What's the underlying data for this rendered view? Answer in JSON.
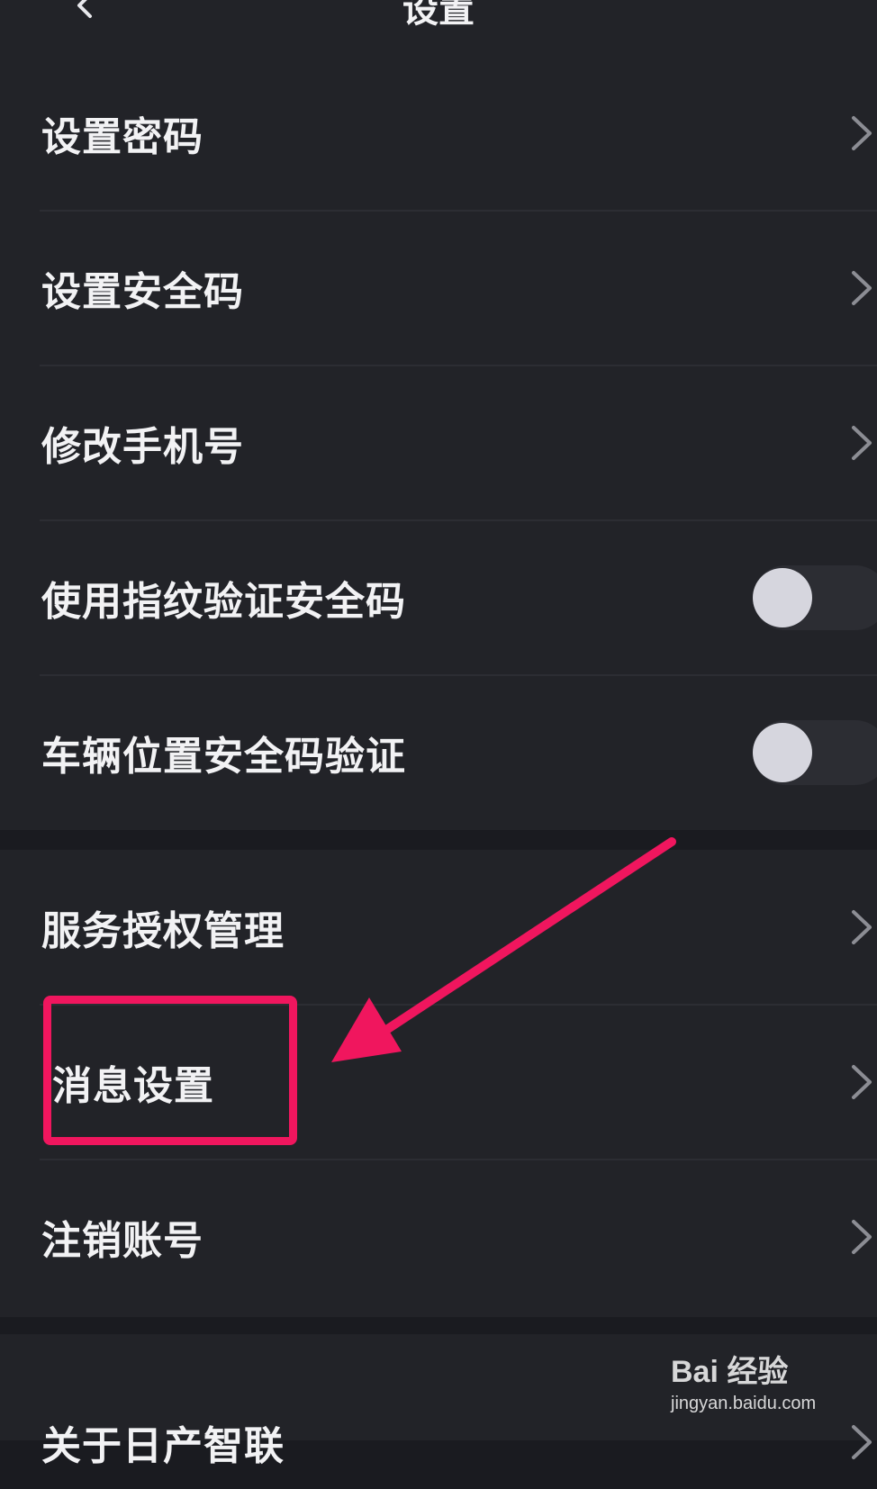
{
  "header": {
    "title": "设置",
    "back_icon": "chevron-left-icon"
  },
  "groups": [
    {
      "items": [
        {
          "label": "设置密码",
          "control": "chevron"
        },
        {
          "label": "设置安全码",
          "control": "chevron"
        },
        {
          "label": "修改手机号",
          "control": "chevron"
        },
        {
          "label": "使用指纹验证安全码",
          "control": "toggle",
          "checked": false
        },
        {
          "label": "车辆位置安全码验证",
          "control": "toggle",
          "checked": false
        }
      ]
    },
    {
      "items": [
        {
          "label": "服务授权管理",
          "control": "chevron"
        },
        {
          "label": "消息设置",
          "control": "chevron",
          "highlighted": true
        },
        {
          "label": "注销账号",
          "control": "chevron"
        }
      ]
    },
    {
      "items": [
        {
          "label": "关于日产智联",
          "control": "chevron"
        }
      ]
    }
  ],
  "annotation": {
    "color": "#f0165e",
    "target": "消息设置"
  },
  "watermark": {
    "logo": "Bai 经验",
    "url": "jingyan.baidu.com"
  },
  "colors": {
    "background": "#1a1b20",
    "card": "#222328",
    "text": "#f2f2f4",
    "accent": "#f0165e",
    "toggle_off_track": "#2c2d33",
    "toggle_knob": "#d6d6de"
  }
}
